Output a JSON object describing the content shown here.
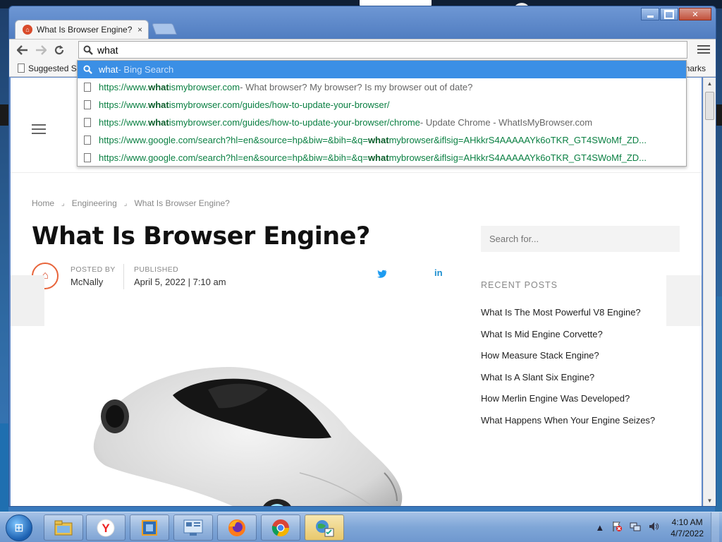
{
  "window": {
    "controls": {
      "minimize": "",
      "maximize": "",
      "close": "✕"
    }
  },
  "tab": {
    "title": "What Is Browser Engine? –",
    "close": "×"
  },
  "toolbar": {
    "omnibox_value": "what"
  },
  "bookmarks": {
    "left": "Suggested Si",
    "right": "marks"
  },
  "suggestions": [
    {
      "bold": "what",
      "rest": "",
      "desc": " - Bing Search",
      "icon": "search-icon",
      "selected": true
    },
    {
      "prefix": "https://www.",
      "bold": "what",
      "rest": "ismybrowser.com",
      "desc": " - What browser? My browser? Is my browser out of date?",
      "icon": "page-icon"
    },
    {
      "prefix": "https://www.",
      "bold": "what",
      "rest": "ismybrowser.com/guides/how-to-update-your-browser/",
      "desc": "",
      "icon": "page-icon"
    },
    {
      "prefix": "https://www.",
      "bold": "what",
      "rest": "ismybrowser.com/guides/how-to-update-your-browser/chrome",
      "desc": " - Update Chrome - WhatIsMyBrowser.com",
      "icon": "page-icon"
    },
    {
      "prefix": "https://www.google.com/search?hl=en&source=hp&biw=&bih=&q=",
      "bold": "what",
      "rest": "mybrowser&iflsig=AHkkrS4AAAAAYk6oTKR_GT4SWoMf_ZD...",
      "desc": "",
      "icon": "page-icon"
    },
    {
      "prefix": "https://www.google.com/search?hl=en&source=hp&biw=&bih=&q=",
      "bold": "what",
      "rest": "mybrowser&iflsig=AHkkrS4AAAAAYk6oTKR_GT4SWoMf_ZD...",
      "desc": "",
      "icon": "page-icon"
    }
  ],
  "article": {
    "breadcrumb": [
      "Home",
      "Engineering",
      "What Is Browser Engine?"
    ],
    "title": "What Is Browser Engine?",
    "posted_by_label": "POSTED BY",
    "author": "McNally",
    "published_label": "PUBLISHED",
    "date": "April 5, 2022 | 7:10 am",
    "share": {
      "twitter": "🐦",
      "linkedin": "in"
    }
  },
  "sidebar": {
    "search_placeholder": "Search for...",
    "recent_heading": "RECENT POSTS",
    "recent_posts": [
      "What Is The Most Powerful V8 Engine?",
      "What Is Mid Engine Corvette?",
      "How Measure Stack Engine?",
      "What Is A Slant Six Engine?",
      "How Merlin Engine Was Developed?",
      "What Happens When Your Engine Seizes?"
    ]
  },
  "taskbar": {
    "apps": [
      "file-explorer",
      "yandex-browser",
      "virtualbox",
      "control-panel",
      "firefox",
      "chrome",
      "network-tool"
    ],
    "clock_time": "4:10 AM",
    "clock_date": "4/7/2022"
  }
}
